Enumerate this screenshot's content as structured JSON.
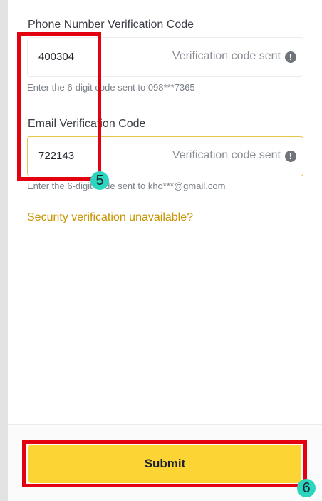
{
  "phone": {
    "label": "Phone Number Verification Code",
    "value": "400304",
    "status": "Verification code sent",
    "hint": "Enter the 6-digit code sent to 098***7365"
  },
  "email": {
    "label": "Email Verification Code",
    "value": "722143",
    "status": "Verification code sent",
    "hint": "Enter the 6-digit code sent to kho***@gmail.com"
  },
  "security_link": "Security verification unavailable?",
  "submit_label": "Submit",
  "annotations": {
    "step_5": "5",
    "step_6": "6"
  },
  "colors": {
    "accent_yellow": "#fcd535",
    "link_gold": "#c99400",
    "highlight_red": "#e3000f",
    "badge_teal": "#2bd5bf"
  },
  "icons": {
    "status_icon": "exclamation-circle-icon"
  }
}
